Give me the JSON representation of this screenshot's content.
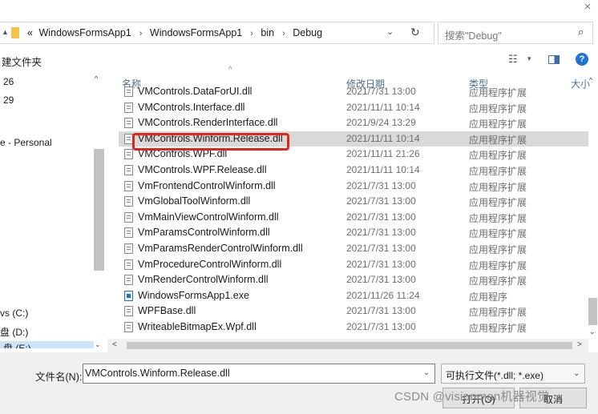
{
  "window": {
    "close_glyph": "×"
  },
  "address_bar": {
    "crumbs": [
      "«",
      "WindowsFormsApp1",
      "WindowsFormsApp1",
      "bin",
      "Debug"
    ],
    "separator": "›",
    "dropdown_glyph": "⌄",
    "refresh_glyph": "↻"
  },
  "search": {
    "placeholder": "搜索\"Debug\"",
    "icon": "search-icon",
    "icon_glyph": "⌕"
  },
  "toolbar": {
    "new_folder_label": "建文件夹",
    "view_glyph": "☷",
    "view_dd_glyph": "▾",
    "help_glyph": "?"
  },
  "nav": {
    "items": [
      {
        "label": "26"
      },
      {
        "label": "29"
      },
      {
        "label": "e - Personal"
      },
      {
        "label": "vs (C:)"
      },
      {
        "label": "盘 (D:)"
      },
      {
        "label": "盘 (E:)"
      }
    ],
    "scroll_up_glyph": "^",
    "scroll_down_glyph": "⌄"
  },
  "columns": {
    "name": "名称",
    "date": "修改日期",
    "type": "类型",
    "size": "大小"
  },
  "files": [
    {
      "name": "VMControls.DataForUI.dll",
      "date": "2021/7/31 13:00",
      "type": "应用程序扩展",
      "kind": "dll"
    },
    {
      "name": "VMControls.Interface.dll",
      "date": "2021/11/11 10:14",
      "type": "应用程序扩展",
      "kind": "dll"
    },
    {
      "name": "VMControls.RenderInterface.dll",
      "date": "2021/9/24 13:29",
      "type": "应用程序扩展",
      "kind": "dll"
    },
    {
      "name": "VMControls.Winform.Release.dll",
      "date": "2021/11/11 10:14",
      "type": "应用程序扩展",
      "kind": "dll",
      "selected": true
    },
    {
      "name": "VMControls.WPF.dll",
      "date": "2021/11/11 21:26",
      "type": "应用程序扩展",
      "kind": "dll"
    },
    {
      "name": "VMControls.WPF.Release.dll",
      "date": "2021/11/11 10:14",
      "type": "应用程序扩展",
      "kind": "dll"
    },
    {
      "name": "VmFrontendControlWinform.dll",
      "date": "2021/7/31 13:00",
      "type": "应用程序扩展",
      "kind": "dll"
    },
    {
      "name": "VmGlobalToolWinform.dll",
      "date": "2021/7/31 13:00",
      "type": "应用程序扩展",
      "kind": "dll"
    },
    {
      "name": "VmMainViewControlWinform.dll",
      "date": "2021/7/31 13:00",
      "type": "应用程序扩展",
      "kind": "dll"
    },
    {
      "name": "VmParamsControlWinform.dll",
      "date": "2021/7/31 13:00",
      "type": "应用程序扩展",
      "kind": "dll"
    },
    {
      "name": "VmParamsRenderControlWinform.dll",
      "date": "2021/7/31 13:00",
      "type": "应用程序扩展",
      "kind": "dll"
    },
    {
      "name": "VmProcedureControlWinform.dll",
      "date": "2021/7/31 13:00",
      "type": "应用程序扩展",
      "kind": "dll"
    },
    {
      "name": "VmRenderControlWinform.dll",
      "date": "2021/7/31 13:00",
      "type": "应用程序扩展",
      "kind": "dll"
    },
    {
      "name": "WindowsFormsApp1.exe",
      "date": "2021/11/26 11:24",
      "type": "应用程序",
      "kind": "exe"
    },
    {
      "name": "WPFBase.dll",
      "date": "2021/7/31 13:00",
      "type": "应用程序扩展",
      "kind": "dll"
    },
    {
      "name": "WriteableBitmapEx.Wpf.dll",
      "date": "2021/7/31 13:00",
      "type": "应用程序扩展",
      "kind": "dll"
    }
  ],
  "scrollbar": {
    "up": "^",
    "down": "⌄",
    "left": "<",
    "right": ">"
  },
  "footer": {
    "filename_label": "文件名(N):",
    "filename_value": "VMControls.Winform.Release.dll",
    "filetype_value": "可执行文件(*.dll; *.exe)",
    "dropdown_glyph": "⌄",
    "open_label": "打开(O)",
    "cancel_label": "取消"
  },
  "watermark": "CSDN @visionman机器视觉",
  "colors": {
    "selection_outline": "#e0251b",
    "help_blue": "#1e73d9",
    "header_text": "#4a6d8c"
  }
}
